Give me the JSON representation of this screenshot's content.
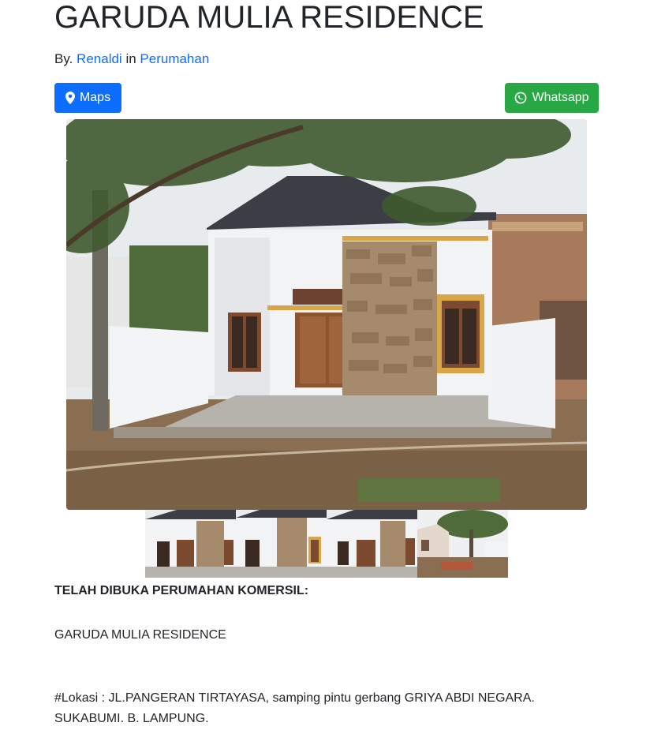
{
  "post": {
    "title": "GARUDA MULIA RESIDENCE",
    "by_label": "By.",
    "author": "Renaldi",
    "in_label": "in",
    "category": "Perumahan"
  },
  "actions": {
    "maps_label": "Maps",
    "whatsapp_label": "Whatsapp",
    "maps_icon": "map-marker-icon",
    "whatsapp_icon": "whatsapp-icon",
    "maps_color": "#0d6efd",
    "whatsapp_color": "#28a745"
  },
  "gallery": {
    "thumbnail_count": 4
  },
  "description": {
    "heading": "TELAH DIBUKA PERUMAHAN KOMERSIL:",
    "name": "GARUDA MULIA RESIDENCE",
    "location": "#Lokasi : JL.PANGERAN TIRTAYASA, samping pintu gerbang GRIYA ABDI NEGARA. SUKABUMI. B. LAMPUNG."
  }
}
